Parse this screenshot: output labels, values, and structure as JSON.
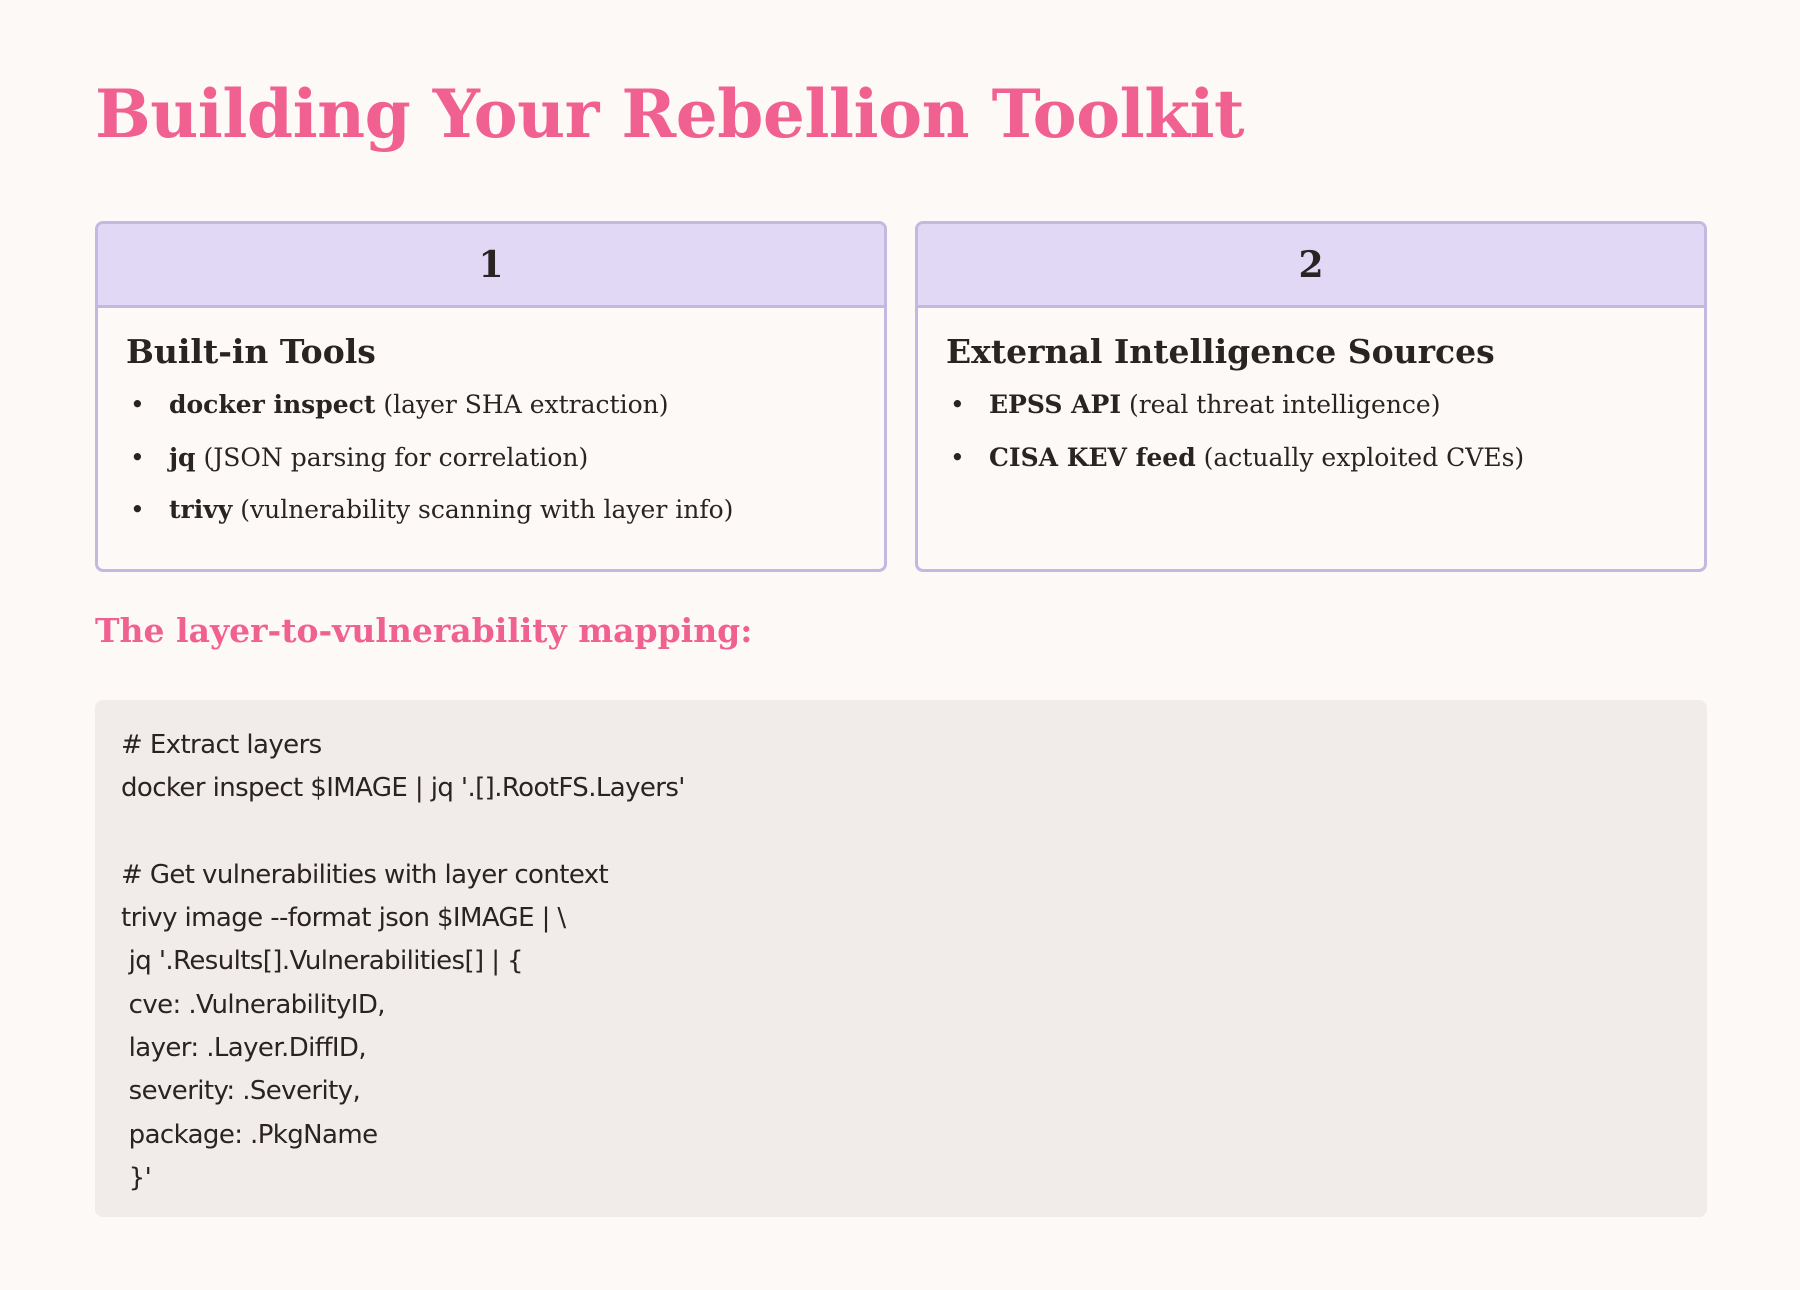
{
  "title": "Building Your Rebellion Toolkit",
  "cards": [
    {
      "number": "1",
      "heading": "Built-in Tools",
      "items": [
        {
          "term": "docker inspect",
          "desc": " (layer SHA extraction)"
        },
        {
          "term": "jq",
          "desc": " (JSON parsing for correlation)"
        },
        {
          "term": "trivy",
          "desc": " (vulnerability scanning with layer info)"
        }
      ]
    },
    {
      "number": "2",
      "heading": "External Intelligence Sources",
      "items": [
        {
          "term": "EPSS API",
          "desc": " (real threat intelligence)"
        },
        {
          "term": "CISA KEV feed",
          "desc": " (actually exploited CVEs)"
        }
      ]
    }
  ],
  "bullet_char": "•",
  "mapping_heading": "The layer-to-vulnerability mapping:",
  "code_lines": [
    "# Extract layers",
    "docker inspect $IMAGE | jq '.[].RootFS.Layers'",
    "",
    "# Get vulnerabilities with layer context",
    "trivy image --format json $IMAGE | \\",
    " jq '.Results[].Vulnerabilities[] | {",
    " cve: .VulnerabilityID,",
    " layer: .Layer.DiffID,",
    " severity: .Severity,",
    " package: .PkgName",
    " }'"
  ],
  "colors": {
    "accent": "#f06192",
    "card_header_bg": "#e0d8f4",
    "card_border": "#c2b8e0",
    "code_bg": "#f1ecea",
    "page_bg": "#fdf9f6"
  }
}
